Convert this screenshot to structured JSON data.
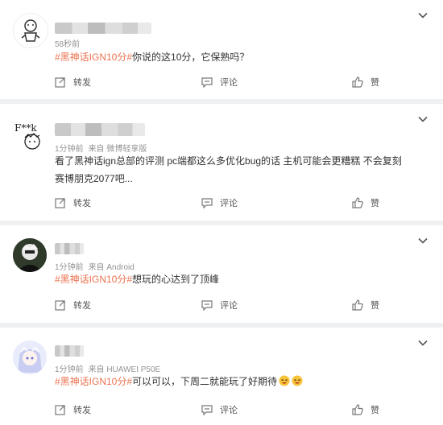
{
  "actions": {
    "forward": "转发",
    "comment": "评论",
    "like": "赞"
  },
  "posts": [
    {
      "time": "58秒前",
      "source": "",
      "hashtag": "#黑神话IGN10分#",
      "text": "你说的这10分，它保熟吗？"
    },
    {
      "time": "1分钟前",
      "source": "来自 微博轻享版",
      "hashtag": "",
      "text": "看了黑神话ign总部的评测 pc端都这么多优化bug的话 主机可能会更糟糕 不会复刻赛博朋克2077吧..."
    },
    {
      "time": "1分钟前",
      "source": "来自 Android",
      "hashtag": "#黑神话IGN10分#",
      "text": "想玩的心达到了顶峰"
    },
    {
      "time": "1分钟前",
      "source": "来自 HUAWEI P50E",
      "hashtag": "#黑神话IGN10分#",
      "text": "可以可以，下周二就能玩了好期待"
    }
  ]
}
